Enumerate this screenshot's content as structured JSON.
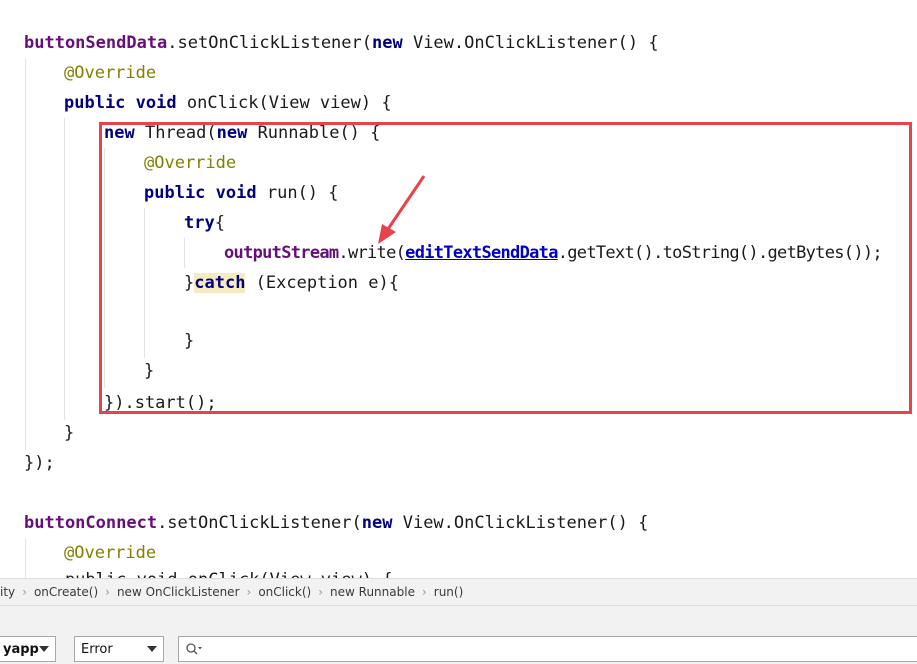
{
  "code": {
    "l1": {
      "obj": "buttonSendData",
      "a": ".setOnClickListener(",
      "kw": "new",
      "b": " View.OnClickListener() {"
    },
    "l2": {
      "ann": "@Override"
    },
    "l3": {
      "kw1": "public",
      "kw2": "void",
      "rest": " onClick(View view) {"
    },
    "l4": {
      "kw1": "new",
      "a": " Thread(",
      "kw2": "new",
      "b": " Runnable() {"
    },
    "l5": {
      "ann": "@Override"
    },
    "l6": {
      "kw1": "public",
      "kw2": "void",
      "rest": " run() {"
    },
    "l7": {
      "kw": "try",
      "rest": "{"
    },
    "l8": {
      "obj": "outputStream",
      "a": ".write(",
      "link": "editTextSendData",
      "b": ".getText().toString().getBytes());"
    },
    "l9": {
      "a": "}",
      "kw": "catch",
      "b": " (Exception e){"
    },
    "l10": {
      "text": "}"
    },
    "l11": {
      "text": "}"
    },
    "l12": {
      "text": "}).start();"
    },
    "l13": {
      "text": "}"
    },
    "l14": {
      "text": "});"
    },
    "l15": {
      "obj": "buttonConnect",
      "a": ".setOnClickListener(",
      "kw": "new",
      "b": " View.OnClickListener() {"
    },
    "l16": {
      "ann": "@Override"
    },
    "l17": {
      "partial": "    public void onClick(View view) {"
    }
  },
  "breadcrumb": [
    "ity",
    "onCreate()",
    "new OnClickListener",
    "onClick()",
    "new Runnable",
    "run()"
  ],
  "toolbar": {
    "module_value": "yapp",
    "level_value": "Error",
    "search_placeholder": ""
  },
  "colors": {
    "highlight_border": "#e8424a",
    "keyword": "#000080",
    "field": "#660e7a",
    "annotation": "#808000"
  },
  "icons": {
    "search": "magnifier-icon"
  }
}
